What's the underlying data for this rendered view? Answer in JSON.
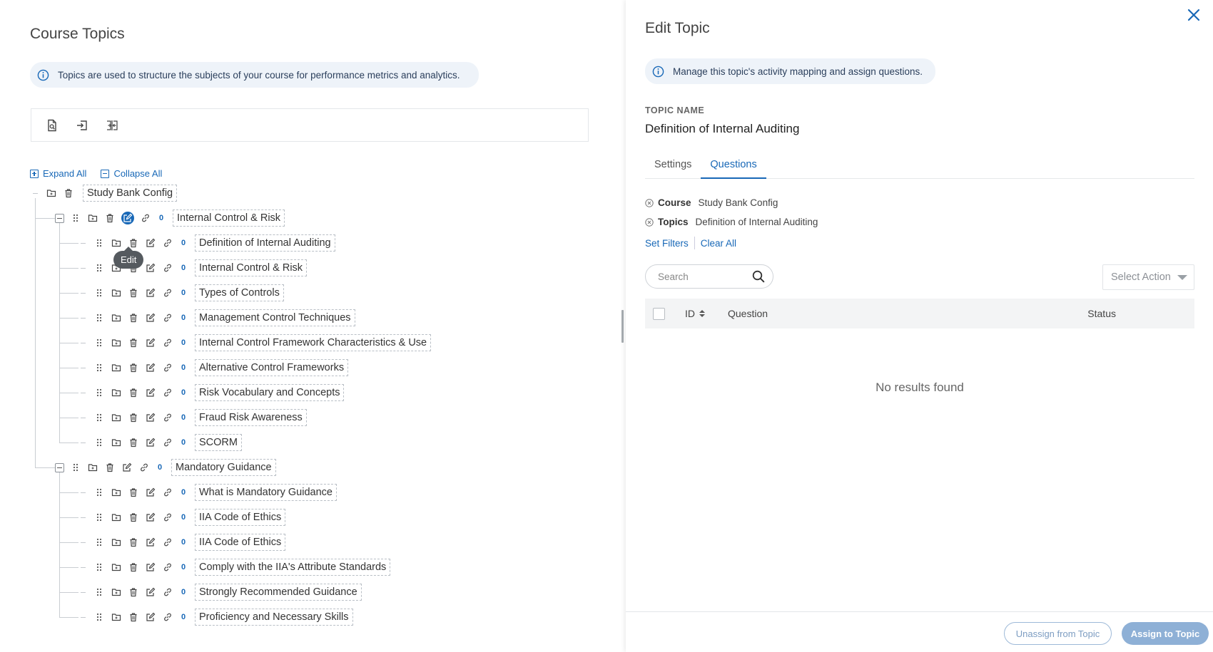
{
  "left": {
    "title": "Course Topics",
    "info": "Topics are used to structure the subjects of your course for performance metrics and analytics.",
    "toolbar": [
      "preview-doc-icon",
      "import-icon",
      "export-icon"
    ],
    "expand_all": "Expand All",
    "collapse_all": "Collapse All",
    "tooltip": "Edit",
    "tree": {
      "root": "Study Bank Config",
      "groups": [
        {
          "label": "Internal Control & Risk",
          "count": "0",
          "children": [
            {
              "label": "Definition of Internal Auditing",
              "count": "0"
            },
            {
              "label": "Internal Control & Risk",
              "count": "0"
            },
            {
              "label": "Types of Controls",
              "count": "0"
            },
            {
              "label": "Management Control Techniques",
              "count": "0"
            },
            {
              "label": "Internal Control Framework Characteristics & Use",
              "count": "0"
            },
            {
              "label": "Alternative Control Frameworks",
              "count": "0"
            },
            {
              "label": "Risk Vocabulary and Concepts",
              "count": "0"
            },
            {
              "label": "Fraud Risk Awareness",
              "count": "0"
            },
            {
              "label": "SCORM",
              "count": "0"
            }
          ]
        },
        {
          "label": "Mandatory Guidance",
          "count": "0",
          "children": [
            {
              "label": "What is Mandatory Guidance",
              "count": "0"
            },
            {
              "label": "IIA Code of Ethics",
              "count": "0"
            },
            {
              "label": "IIA Code of Ethics",
              "count": "0"
            },
            {
              "label": "Comply with the IIA's Attribute Standards",
              "count": "0"
            },
            {
              "label": "Strongly Recommended Guidance",
              "count": "0"
            },
            {
              "label": "Proficiency and Necessary Skills",
              "count": "0"
            }
          ]
        }
      ]
    }
  },
  "right": {
    "title": "Edit Topic",
    "info": "Manage this topic's activity mapping and assign questions.",
    "topic_name_label": "TOPIC NAME",
    "topic_name": "Definition of Internal Auditing",
    "tabs": [
      {
        "label": "Settings",
        "active": false
      },
      {
        "label": "Questions",
        "active": true
      }
    ],
    "filters": [
      {
        "key": "Course",
        "value": "Study Bank Config"
      },
      {
        "key": "Topics",
        "value": "Definition of Internal Auditing"
      }
    ],
    "set_filters": "Set Filters",
    "clear_all": "Clear All",
    "search_placeholder": "Search",
    "select_action": "Select Action",
    "columns": {
      "id": "ID",
      "question": "Question",
      "status": "Status"
    },
    "empty": "No results found",
    "unassign": "Unassign from Topic",
    "assign": "Assign to Topic"
  },
  "colors": {
    "accent": "#1868b7",
    "primary_btn": "#8eb0d6"
  }
}
